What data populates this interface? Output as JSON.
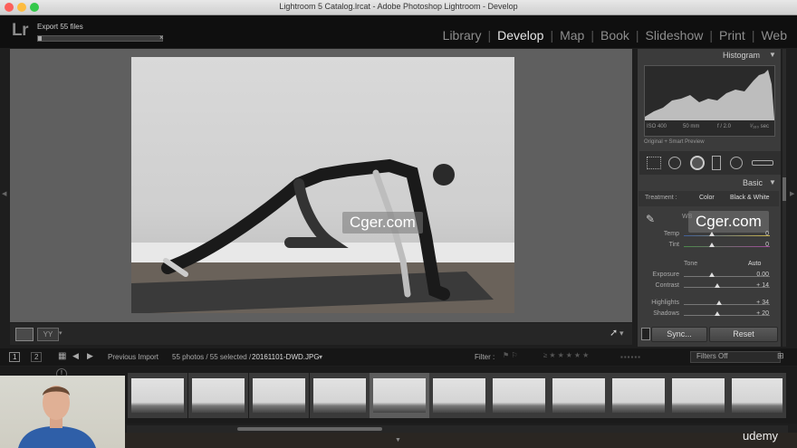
{
  "window": {
    "title": "Lightroom 5 Catalog.lrcat - Adobe Photoshop Lightroom - Develop"
  },
  "app": {
    "logo": "Lr"
  },
  "export": {
    "label": "Export 55 files",
    "progress": 0.03,
    "close": "×"
  },
  "modules": [
    "Library",
    "Develop",
    "Map",
    "Book",
    "Slideshow",
    "Print",
    "Web"
  ],
  "active_module": "Develop",
  "watermark": "Cger.com",
  "right_panel": {
    "histogram_title": "Histogram",
    "iso": "ISO 400",
    "focal": "50 mm",
    "aperture": "f / 2.0",
    "shutter": "¹⁄₁₆₀ sec",
    "preview_label": "Original + Smart Preview",
    "basic_title": "Basic",
    "treatment_label": "Treatment :",
    "treatment_color": "Color",
    "treatment_bw": "Black & White",
    "wb_label": "WB",
    "temp": {
      "label": "Temp",
      "value": "0"
    },
    "tint": {
      "label": "Tint",
      "value": "0"
    },
    "tone_label": "Tone",
    "auto_label": "Auto",
    "exposure": {
      "label": "Exposure",
      "value": "0.00"
    },
    "contrast": {
      "label": "Contrast",
      "value": "+ 14"
    },
    "highlights": {
      "label": "Highlights",
      "value": "+ 34"
    },
    "shadows": {
      "label": "Shadows",
      "value": "+ 20"
    },
    "sync_label": "Sync...",
    "reset_label": "Reset"
  },
  "filmbar": {
    "view1": "1",
    "view2": "2",
    "prev_import": "Previous Import",
    "count": "55 photos / 55 selected /",
    "filename": "20161101-DWD.JPG",
    "filter_label": "Filter :",
    "filters_off": "Filters Off"
  },
  "brand": "udemy"
}
